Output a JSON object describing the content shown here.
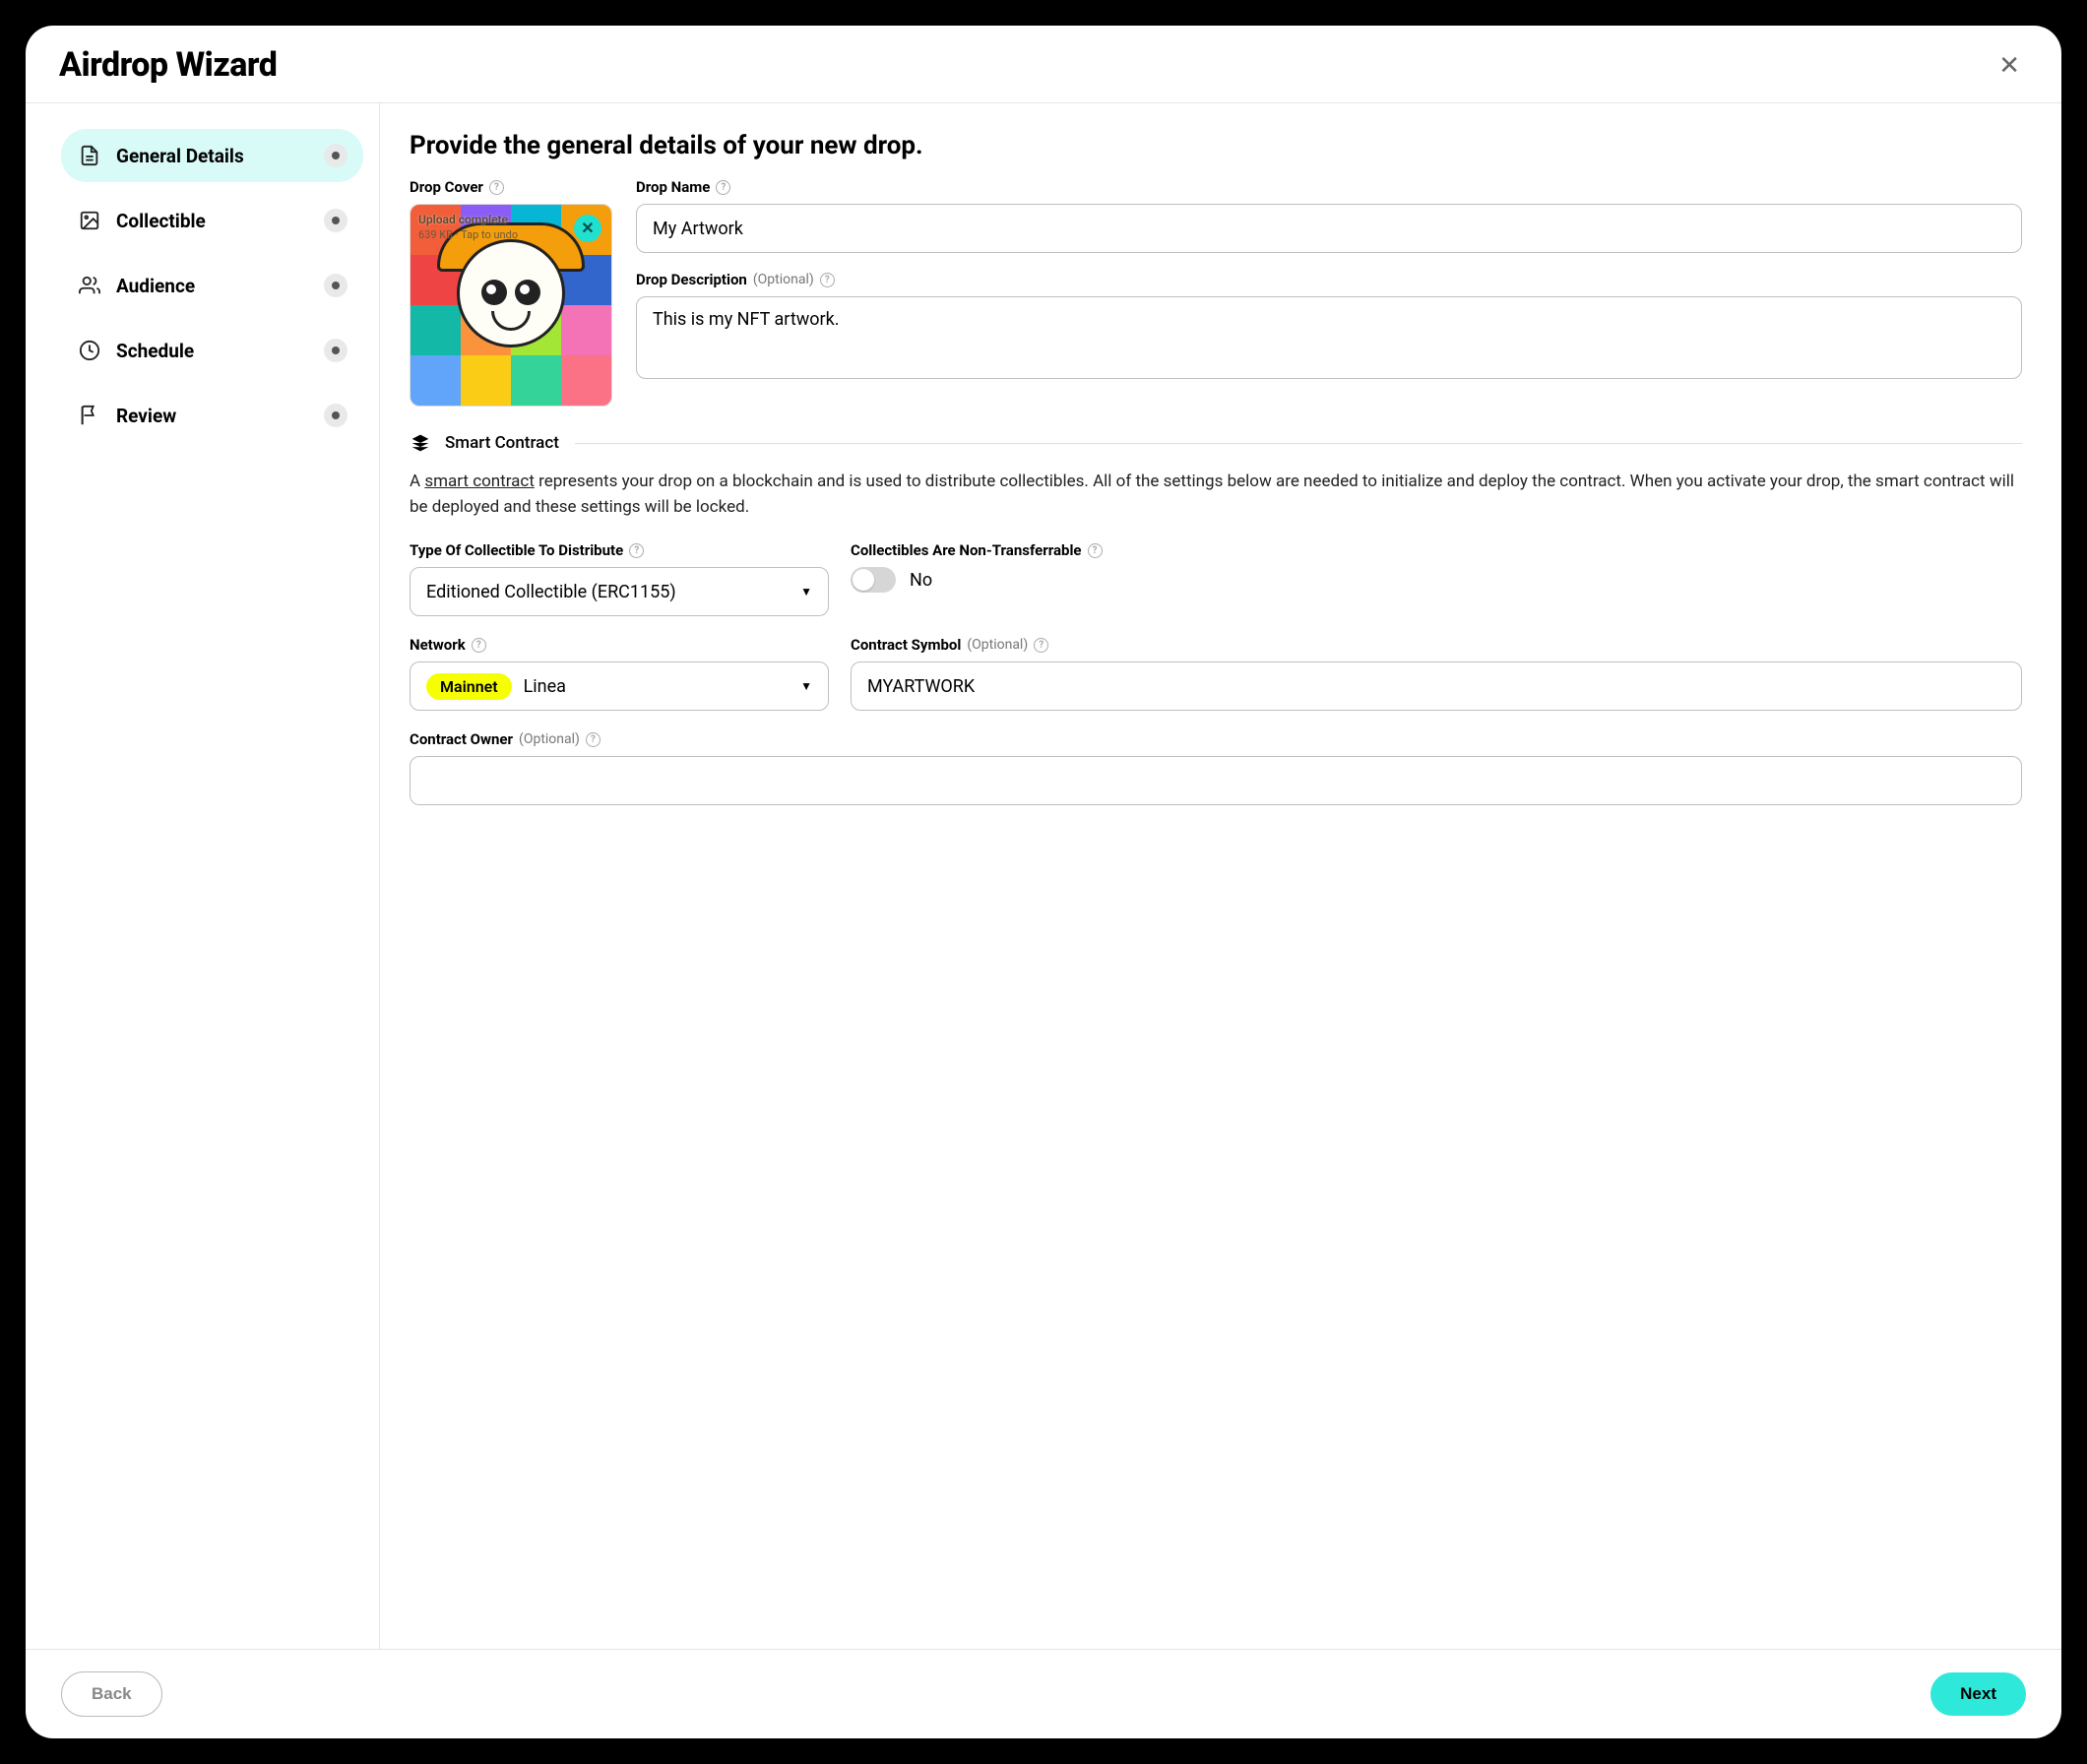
{
  "modal": {
    "title": "Airdrop Wizard",
    "close_label": "✕"
  },
  "sidebar": {
    "steps": [
      {
        "label": "General Details",
        "icon": "file-icon",
        "active": true
      },
      {
        "label": "Collectible",
        "icon": "image-icon",
        "active": false
      },
      {
        "label": "Audience",
        "icon": "people-icon",
        "active": false
      },
      {
        "label": "Schedule",
        "icon": "clock-icon",
        "active": false
      },
      {
        "label": "Review",
        "icon": "flag-icon",
        "active": false
      }
    ]
  },
  "content": {
    "heading": "Provide the general details of your new drop.",
    "drop_cover_label": "Drop Cover",
    "upload_status_text": "Upload complete",
    "upload_size_text": "639 KB",
    "upload_undo_text": "Tap to undo",
    "drop_name_label": "Drop Name",
    "drop_name_value": "My Artwork",
    "drop_description_label": "Drop Description",
    "drop_description_optional": "(Optional)",
    "drop_description_value": "This is my NFT artwork.",
    "smart_contract_label": "Smart Contract",
    "smart_contract_help_prefix": "A ",
    "smart_contract_link_text": "smart contract",
    "smart_contract_help_rest": " represents your drop on a blockchain and is used to distribute collectibles. All of the settings below are needed to initialize and deploy the contract. When you activate your drop, the smart contract will be deployed and these settings will be locked.",
    "type_label": "Type Of Collectible To Distribute",
    "type_value": "Editioned Collectible (ERC1155)",
    "non_transferrable_label": "Collectibles Are Non-Transferrable",
    "non_transferrable_value": "No",
    "network_label": "Network",
    "network_badge": "Mainnet",
    "network_value": "Linea",
    "contract_symbol_label": "Contract Symbol",
    "contract_symbol_optional": "(Optional)",
    "contract_symbol_value": "MYARTWORK",
    "contract_owner_label": "Contract Owner",
    "contract_owner_optional": "(Optional)",
    "contract_owner_value": ""
  },
  "footer": {
    "back_label": "Back",
    "next_label": "Next"
  }
}
